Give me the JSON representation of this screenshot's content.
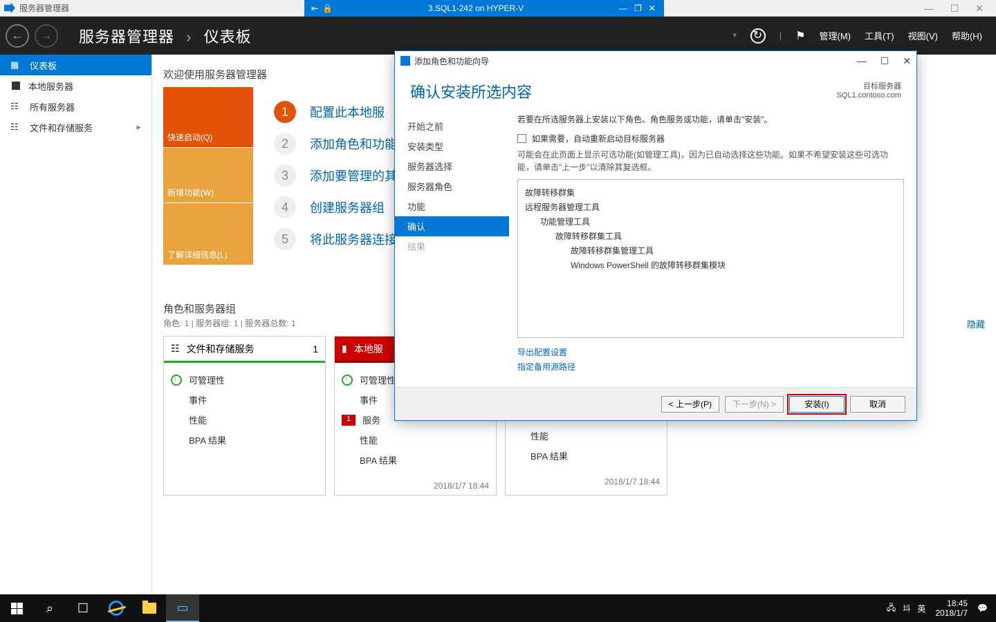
{
  "vm": {
    "appTitle": "服务器管理器",
    "name": "3.SQL1-242 on HYPER-V"
  },
  "winControls": {
    "min": "—",
    "max": "☐",
    "close": "✕"
  },
  "header": {
    "crumb1": "服务器管理器",
    "crumb2": "仪表板",
    "menu": {
      "manage": "管理(M)",
      "tools": "工具(T)",
      "view": "视图(V)",
      "help": "帮助(H)"
    }
  },
  "sidebar": {
    "items": [
      {
        "label": "仪表板"
      },
      {
        "label": "本地服务器"
      },
      {
        "label": "所有服务器"
      },
      {
        "label": "文件和存储服务"
      }
    ]
  },
  "welcome": "欢迎使用服务器管理器",
  "tiles": {
    "t1": "快速启动(Q)",
    "t2": "新增功能(W)",
    "t3": "了解详细信息(L)"
  },
  "steps": {
    "s1": "配置此本地服",
    "s2": "添加角色和功能",
    "s3": "添加要管理的其",
    "s4": "创建服务器组",
    "s5": "将此服务器连接"
  },
  "hide": "隐藏",
  "rolesHeader": "角色和服务器组",
  "rolesSub": "角色: 1 | 服务器组: 1 | 服务器总数: 1",
  "cards": {
    "c1": {
      "title": "文件和存储服务",
      "count": "1",
      "rows": [
        "可管理性",
        "事件",
        "性能",
        "BPA 结果"
      ]
    },
    "c2": {
      "title": "本地服",
      "count": "",
      "rows": [
        "可管理性",
        "事件",
        "服务",
        "性能",
        "BPA 结果"
      ],
      "err": "1",
      "ts": "2018/1/7 18:44"
    },
    "c3": {
      "rows": [
        "性能",
        "BPA 结果"
      ],
      "ts": "2018/1/7 18:44"
    }
  },
  "wizard": {
    "title": "添加角色和功能向导",
    "heading": "确认安装所选内容",
    "targetLabel": "目标服务器",
    "targetServer": "SQL1.contoso.com",
    "nav": [
      "开始之前",
      "安装类型",
      "服务器选择",
      "服务器角色",
      "功能",
      "确认",
      "结果"
    ],
    "msg": "若要在所选服务器上安装以下角色、角色服务或功能，请单击\"安装\"。",
    "checkbox": "如果需要，自动重新启动目标服务器",
    "note": "可能会在此页面上显示可选功能(如管理工具)，因为已自动选择这些功能。如果不希望安装这些可选功能，请单击\"上一步\"以清除其复选框。",
    "features": {
      "f1": "故障转移群集",
      "f2": "远程服务器管理工具",
      "f3": "功能管理工具",
      "f4": "故障转移群集工具",
      "f5": "故障转移群集管理工具",
      "f6": "Windows PowerShell 的故障转移群集模块"
    },
    "links": {
      "l1": "导出配置设置",
      "l2": "指定备用源路径"
    },
    "buttons": {
      "prev": "< 上一步(P)",
      "next": "下一步(N) >",
      "install": "安装(I)",
      "cancel": "取消"
    }
  },
  "taskbar": {
    "ime1": "㘰",
    "ime2": "英",
    "time": "18:45",
    "date": "2018/1/7"
  }
}
